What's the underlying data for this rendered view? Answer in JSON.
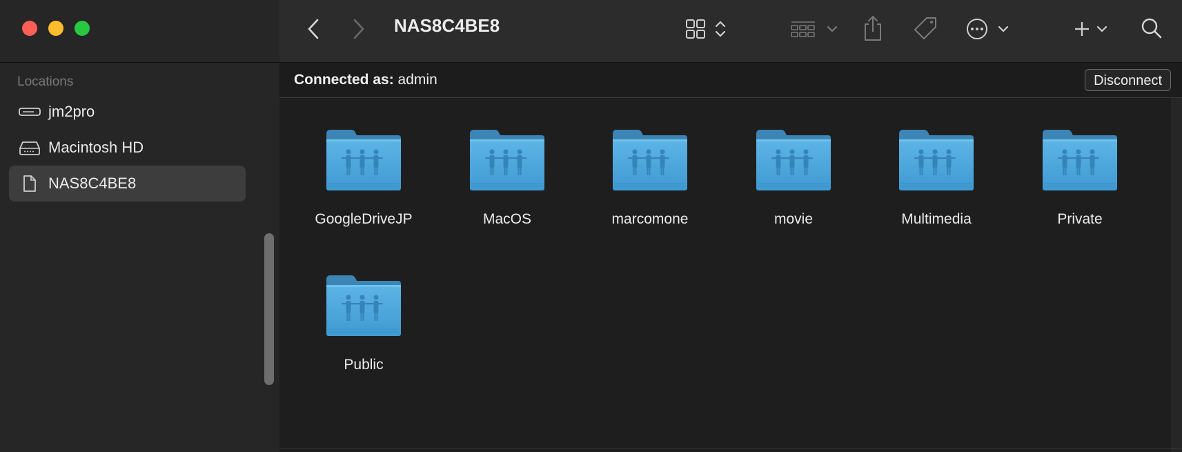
{
  "window": {
    "title": "NAS8C4BE8"
  },
  "sidebar": {
    "section_title": "Locations",
    "items": [
      {
        "label": "jm2pro",
        "icon": "drive-icon"
      },
      {
        "label": "Macintosh HD",
        "icon": "hard-disk-icon"
      },
      {
        "label": "NAS8C4BE8",
        "icon": "document-icon",
        "selected": true
      }
    ]
  },
  "toolbar": {
    "back": "back-icon",
    "forward": "forward-icon",
    "view": "grid-view-icon",
    "group": "group-icon",
    "share": "share-icon",
    "tag": "tag-icon",
    "more": "more-icon",
    "add": "add-icon",
    "search": "search-icon"
  },
  "connection": {
    "label": "Connected as:",
    "user": "admin",
    "disconnect_label": "Disconnect"
  },
  "folders": [
    {
      "name": "GoogleDriveJP"
    },
    {
      "name": "MacOS"
    },
    {
      "name": "marcomone"
    },
    {
      "name": "movie"
    },
    {
      "name": "Multimedia"
    },
    {
      "name": "Private"
    },
    {
      "name": "Public"
    }
  ],
  "colors": {
    "accent_folder": "#4aa7dc",
    "close": "#ff5f57",
    "minimize": "#febc2e",
    "maximize": "#28c840"
  }
}
